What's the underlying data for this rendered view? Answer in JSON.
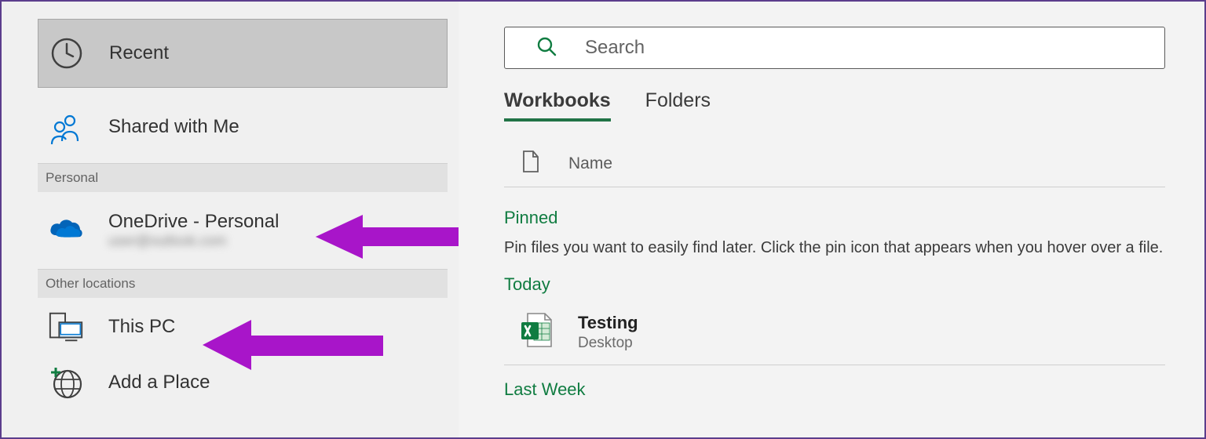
{
  "sidebar": {
    "recent_label": "Recent",
    "shared_label": "Shared with Me",
    "personal_header": "Personal",
    "onedrive_label": "OneDrive - Personal",
    "onedrive_sublabel": "user@outlook.com",
    "other_locations_header": "Other locations",
    "thispc_label": "This PC",
    "addplace_label": "Add a Place"
  },
  "search": {
    "placeholder": "Search"
  },
  "tabs": {
    "workbooks": "Workbooks",
    "folders": "Folders"
  },
  "list": {
    "name_col": "Name"
  },
  "groups": {
    "pinned_title": "Pinned",
    "pinned_hint": "Pin files you want to easily find later. Click the pin icon that appears when you hover over a file.",
    "today_title": "Today",
    "lastweek_title": "Last Week"
  },
  "files": {
    "testing_name": "Testing",
    "testing_loc": "Desktop"
  }
}
